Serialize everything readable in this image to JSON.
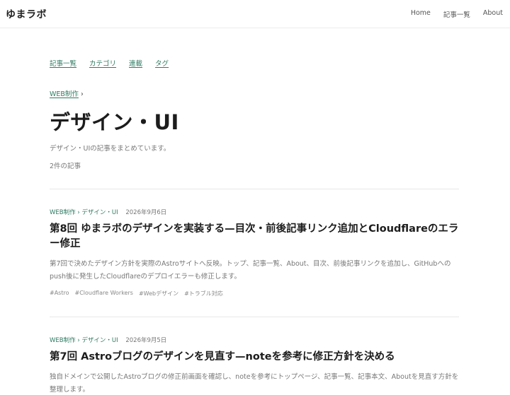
{
  "header": {
    "logo": "ゆまラボ",
    "nav": [
      {
        "label": "Home"
      },
      {
        "label": "記事一覧"
      },
      {
        "label": "About"
      }
    ]
  },
  "subnav": [
    {
      "label": "記事一覧"
    },
    {
      "label": "カテゴリ"
    },
    {
      "label": "連載"
    },
    {
      "label": "タグ"
    }
  ],
  "breadcrumb": {
    "parent": "WEB制作",
    "separator": "›"
  },
  "page": {
    "title": "デザイン・UI",
    "description": "デザイン・UIの記事をまとめています。",
    "count": "2件の記事"
  },
  "posts": [
    {
      "category": "WEB制作 › デザイン・UI",
      "date": "2026年9月6日",
      "title": "第8回 ゆまラボのデザインを実装する—目次・前後記事リンク追加とCloudflareのエラー修正",
      "excerpt": "第7回で決めたデザイン方針を実際のAstroサイトへ反映。トップ、記事一覧、About、目次、前後記事リンクを追加し、GitHubへのpush後に発生したCloudflareのデプロイエラーも修正します。",
      "tags": [
        "#Astro",
        "#Cloudflare Workers",
        "#Webデザイン",
        "#トラブル対応"
      ]
    },
    {
      "category": "WEB制作 › デザイン・UI",
      "date": "2026年9月5日",
      "title": "第7回 Astroブログのデザインを見直す—noteを参考に修正方針を決める",
      "excerpt": "独自ドメインで公開したAstroブログの修正前画面を確認し、noteを参考にトップページ、記事一覧、記事本文、Aboutを見直す方針を整理します。",
      "tags": []
    }
  ],
  "colors": {
    "accent": "#2f7a63",
    "muted": "#777777",
    "divider": "#e8e8e8"
  }
}
